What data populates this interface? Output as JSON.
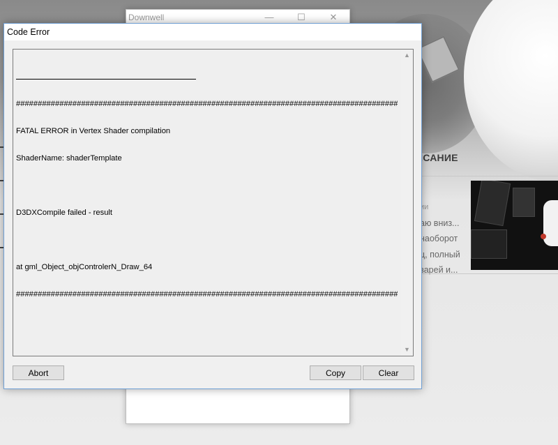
{
  "background": {
    "section_title": "ИСАНИЕ",
    "desc_muted": "ии",
    "desc_lines": [
      "аю вниз...",
      "наоборот",
      "ц, полный",
      "зарей и..."
    ]
  },
  "downwell_window": {
    "title": "Downwell",
    "minimize": "—",
    "maximize": "☐",
    "close": "✕"
  },
  "dialog": {
    "title": "Code Error",
    "hash_line": "#############################################################################################",
    "lines": [
      "FATAL ERROR in Vertex Shader compilation",
      "ShaderName: shaderTemplate",
      "",
      "D3DXCompile failed - result",
      "",
      "at gml_Object_objControlerN_Draw_64"
    ],
    "buttons": {
      "abort": "Abort",
      "copy": "Copy",
      "clear": "Clear"
    },
    "scroll_up": "▲",
    "scroll_down": "▼"
  }
}
